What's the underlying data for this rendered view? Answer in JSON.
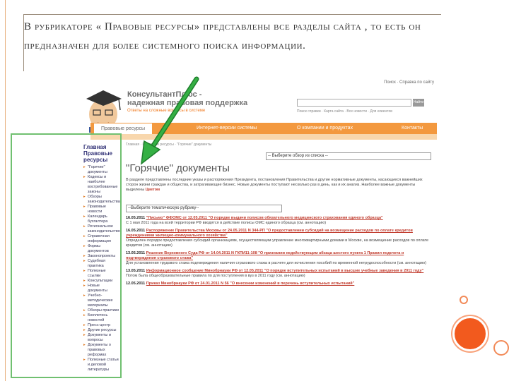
{
  "slide": {
    "caption": "В рубрикаторе « Правовые ресурсы» представлены все разделы сайта , то есть он предназначен для более системного поиска информации."
  },
  "site": {
    "top_links": "Поиск · Справка по сайту",
    "brand_line1": "КонсультантПлюс -",
    "brand_line2": "надежная правовая поддержка",
    "brand_sub": "Ответы на сложные вопросы в системе",
    "search_links": "Поиск справки · Карта сайта · Все новости · Для клиентов",
    "search_button": "Найти",
    "nav": [
      "Правовые ресурсы",
      "Интернет-версии системы",
      "О компании и продуктах",
      "Контакты"
    ],
    "sidebar_title1": "Главная",
    "sidebar_title2": "Правовые ресурсы",
    "sidebar_items": [
      "\"Горячие\" документы",
      "Кодексы и наиболее востребованные законы",
      "Обзоры законодательства",
      "Правовые новости",
      "Календарь бухгалтера",
      "Региональное законодательство",
      "Справочная информация",
      "Формы документов",
      "Законопроекты",
      "Судебная практика",
      "Полезные ссылки",
      "Консультации",
      "Новые документы",
      "Учебно-методические материалы",
      "Обзоры практики",
      "Бюллетень новостей",
      "Пресс-центр",
      "Другие ресурсы",
      "Документы и вопросы",
      "Документы о правовых реформах",
      "Полезные статьи и деловой литературы"
    ],
    "breadcrumbs": "Главная · Правовые ресурсы · \"Горячие\" документы",
    "section_select": "-- Выберите обзор из списка --",
    "page_title": "\"Горячие\" документы",
    "intro": "В разделе представлены последние указы и распоряжения Президента, постановления Правительства и другие нормативные документы, касающиеся важнейших сторон жизни граждан и общества, и затрагивающие бизнес. Новые документы поступают несколько раз в день, как и их анализ. Наиболее важные документы выделены",
    "intro_bold": "Цветом",
    "theme_select": "--Выберите тематическую рубрику--",
    "news": [
      {
        "date": "16.05.2011",
        "head": "\"Письмо\" ФФОМС от 12.05.2011 \"О порядке выдачи полисов обязательного медицинского страхования единого образца\"",
        "text": "С 1 мая 2011 года на всей территории РФ вводятся в действие полисы ОМС единого образца (см. аннотацию)"
      },
      {
        "date": "16.05.2011",
        "head": "Распоряжение Правительства Москвы от 24.05.2011 N 344-РП \"О предоставлении субсидий на возмещение расходов по оплате кредитов учреждениями жилищно-коммунального хозяйства\"",
        "text": "Определен порядок предоставления субсидий организациям, осуществляющим управление многоквартирными домами в Москве, на возмещение расходов по оплате кредитов (см. аннотацию)"
      },
      {
        "date": "13.05.2011",
        "head": "Решение Верховного Суда РФ от 14.04.2011 N ГКПИ11-108 \"О признании недействующим абзаца шестого пункта 1 Правил подсчета и подтверждения страхового стажа\"",
        "text": "Для установления трудового стажа подтверждения наличия страхового стажа в расчете для исчисления пособий по временной нетрудоспособности (см. аннотацию)"
      },
      {
        "date": "13.05.2011",
        "head": "Информационное сообщение Минобрнауки РФ от 12.05.2011 \"О порядке вступительных испытаний в высшие учебные заведения в 2011 году\"",
        "text": "Потом была общеобразовательные правила по для поступления в вуз в 2011 году (см. аннотацию)"
      },
      {
        "date": "12.05.2011",
        "head": "Приказ Минобрнауки РФ от 24.01.2011 N 56 \"О внесении изменений в перечень вступительных испытаний\"",
        "text": ""
      }
    ]
  },
  "colors": {
    "accent": "#f3993f",
    "link": "#c0392b",
    "frame": "#70c070",
    "arrow": "#2e9e3c",
    "deco": "#f25a1e"
  }
}
